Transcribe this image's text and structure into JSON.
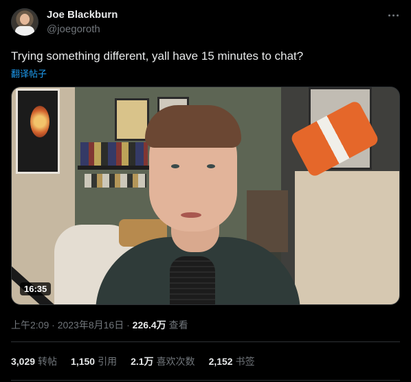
{
  "author": {
    "display_name": "Joe Blackburn",
    "handle": "@joegoroth"
  },
  "tweet": {
    "text": "Trying something different, yall have 15 minutes to chat?",
    "translate_label": "翻译帖子"
  },
  "media": {
    "duration": "16:35"
  },
  "meta": {
    "time": "上午2:09",
    "separator1": " · ",
    "date": "2023年8月16日",
    "separator2": " · ",
    "views_count": "226.4万",
    "views_label": "查看"
  },
  "stats": [
    {
      "count": "3,029",
      "label": "转帖"
    },
    {
      "count": "1,150",
      "label": "引用"
    },
    {
      "count": "2.1万",
      "label": "喜欢次数"
    },
    {
      "count": "2,152",
      "label": "书签"
    }
  ],
  "icons": {
    "more": "more-horizontal-icon"
  },
  "colors": {
    "background": "#000000",
    "text_primary": "#e7e9ea",
    "text_secondary": "#71767b",
    "link": "#1d9bf0",
    "divider": "#2f3336"
  }
}
